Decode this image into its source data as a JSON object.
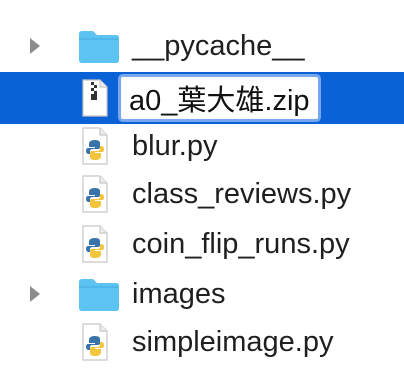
{
  "rows": [
    {
      "name": "__pycache__",
      "kind": "folder",
      "icon": "folder-icon",
      "disclosure": "collapsed"
    },
    {
      "name": "a0_葉大雄.zip",
      "kind": "zip",
      "icon": "zip-file-icon",
      "selected": true,
      "editing": true
    },
    {
      "name": "blur.py",
      "kind": "python",
      "icon": "python-file-icon"
    },
    {
      "name": "class_reviews.py",
      "kind": "python",
      "icon": "python-file-icon"
    },
    {
      "name": "coin_flip_runs.py",
      "kind": "python",
      "icon": "python-file-icon"
    },
    {
      "name": "images",
      "kind": "folder",
      "icon": "folder-icon",
      "disclosure": "collapsed"
    },
    {
      "name": "simpleimage.py",
      "kind": "python",
      "icon": "python-file-icon"
    }
  ],
  "colors": {
    "selection": "#0b61d6",
    "rename_focus_ring": "#77a8ee",
    "folder": "#5cc3f3",
    "disclosure": "#8c8c8c",
    "python_blue": "#3874a8",
    "python_yellow": "#f2c53d"
  }
}
